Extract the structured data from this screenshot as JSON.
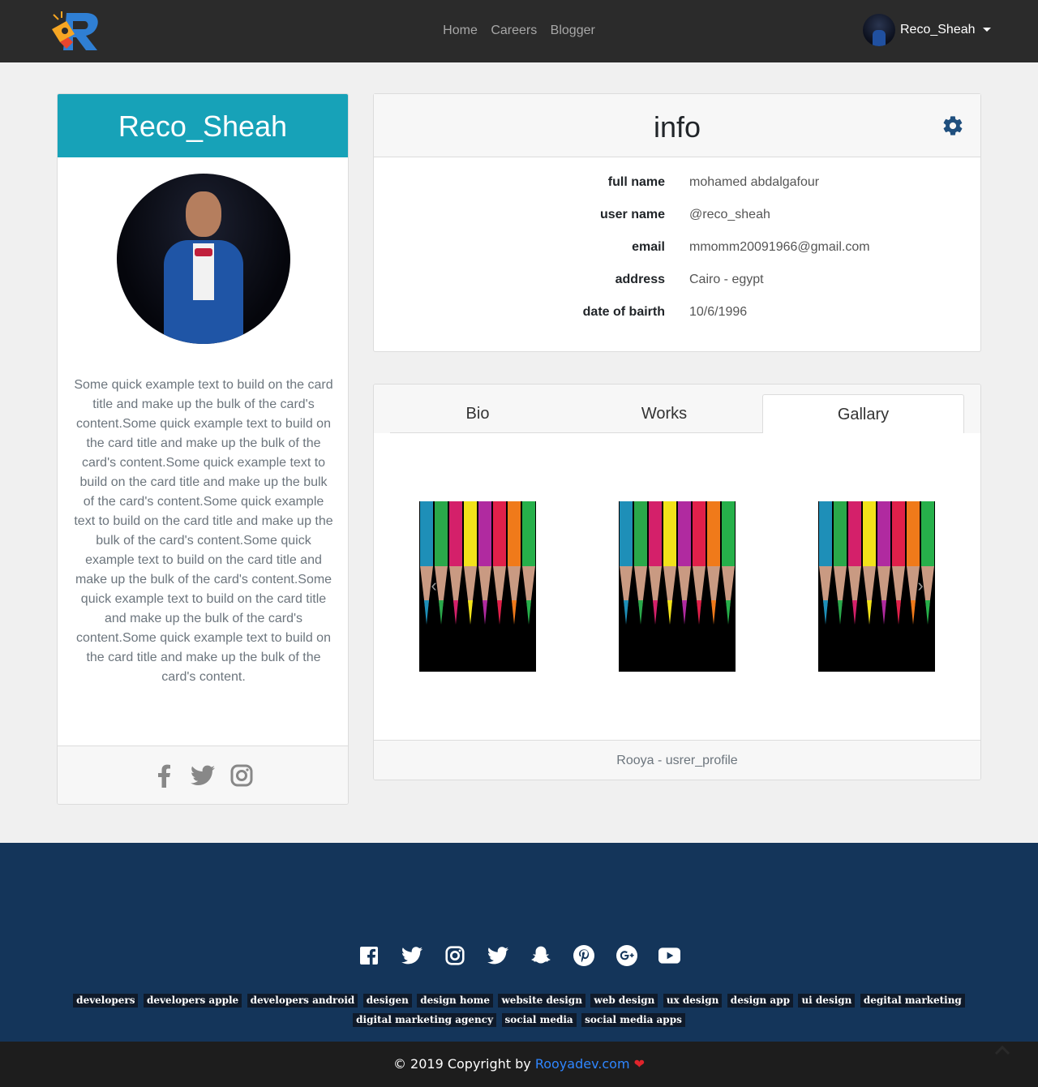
{
  "nav": {
    "links": [
      "Home",
      "Careers",
      "Blogger"
    ],
    "user_name": "Reco_Sheah"
  },
  "profile": {
    "name": "Reco_Sheah",
    "bio": "Some quick example text to build on the card title and make up the bulk of the card's content.Some quick example text to build on the card title and make up the bulk of the card's content.Some quick example text to build on the card title and make up the bulk of the card's content.Some quick example text to build on the card title and make up the bulk of the card's content.Some quick example text to build on the card title and make up the bulk of the card's content.Some quick example text to build on the card title and make up the bulk of the card's content.Some quick example text to build on the card title and make up the bulk of the card's content.",
    "social_icons": [
      "facebook-icon",
      "twitter-icon",
      "instagram-icon"
    ]
  },
  "info": {
    "title": "info",
    "rows": [
      {
        "label": "full name",
        "value": "mohamed abdalgafour"
      },
      {
        "label": "user name",
        "value": "@reco_sheah"
      },
      {
        "label": "email",
        "value": "mmomm20091966@gmail.com"
      },
      {
        "label": "address",
        "value": "Cairo - egypt"
      },
      {
        "label": "date of bairth",
        "value": "10/6/1996"
      }
    ]
  },
  "tabs": {
    "items": [
      "Bio",
      "Works",
      "Gallary"
    ],
    "active": "Gallary",
    "footer": "Rooya - usrer_profile"
  },
  "footer": {
    "social_icons": [
      "facebook-icon",
      "twitter-icon",
      "instagram-icon",
      "twitter-icon",
      "snapchat-icon",
      "pinterest-icon",
      "google-plus-icon",
      "youtube-icon"
    ],
    "tags": [
      "developers",
      "developers apple",
      "developers android",
      "desigen",
      "design home",
      "website design",
      "web design",
      "ux design",
      "design app",
      "ui design",
      "degital marketing",
      "digital marketing agency",
      "social media",
      "social media apps"
    ],
    "copyright_prefix": "© 2019 Copyright by",
    "copyright_link": "Rooyadev.com",
    "heart": "❤"
  },
  "colors": {
    "navbar": "#2b2b2b",
    "profile_header": "#17a2b8",
    "gear": "#1f4f7e",
    "footer": "#14355a",
    "copy_bar": "#1d1d1d",
    "link": "#2f86ff"
  }
}
